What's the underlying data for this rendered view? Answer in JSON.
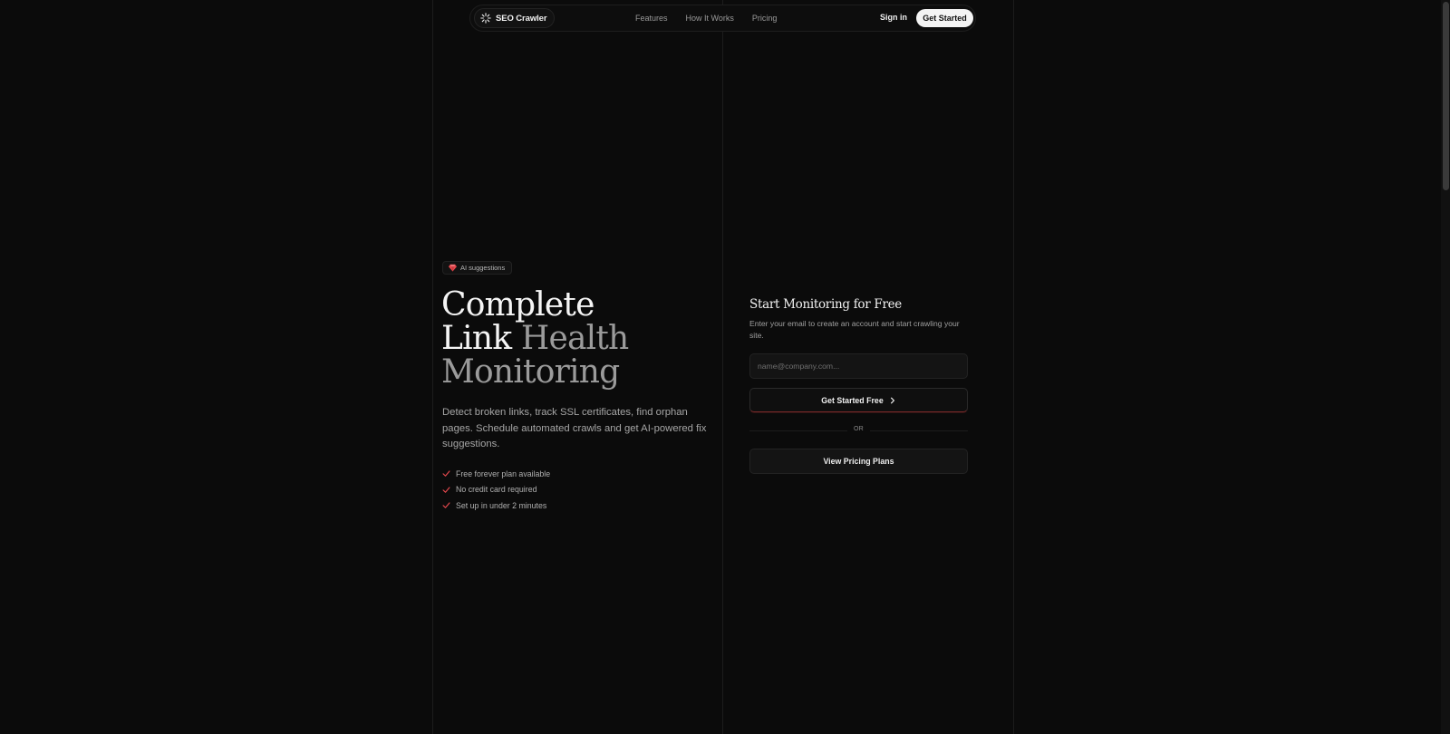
{
  "nav": {
    "brand": "SEO Crawler",
    "brand_icon": "sparkle-icon",
    "links": [
      "Features",
      "How It Works",
      "Pricing"
    ],
    "signin": "Sign in",
    "cta": "Get Started"
  },
  "hero": {
    "badge": "AI suggestions",
    "badge_icon": "gem-icon",
    "headline_line1": "Complete",
    "headline_line2_a": "Link",
    "headline_line2_b": "Health",
    "headline_line3": "Monitoring",
    "description": "Detect broken links, track SSL certificates, find orphan pages. Schedule automated crawls and get AI-powered fix suggestions.",
    "checklist": [
      "Free forever plan available",
      "No credit card required",
      "Set up in under 2 minutes"
    ]
  },
  "signup": {
    "title": "Start Monitoring for Free",
    "description": "Enter your email to create an account and start crawling your site.",
    "email_placeholder": "name@company.com...",
    "primary_label": "Get Started Free",
    "divider": "OR",
    "secondary_label": "View Pricing Plans"
  },
  "colors": {
    "background": "#0b0b0b",
    "accent": "#e5484d",
    "text": "#f5f5f5",
    "muted": "#9b9b9b"
  }
}
